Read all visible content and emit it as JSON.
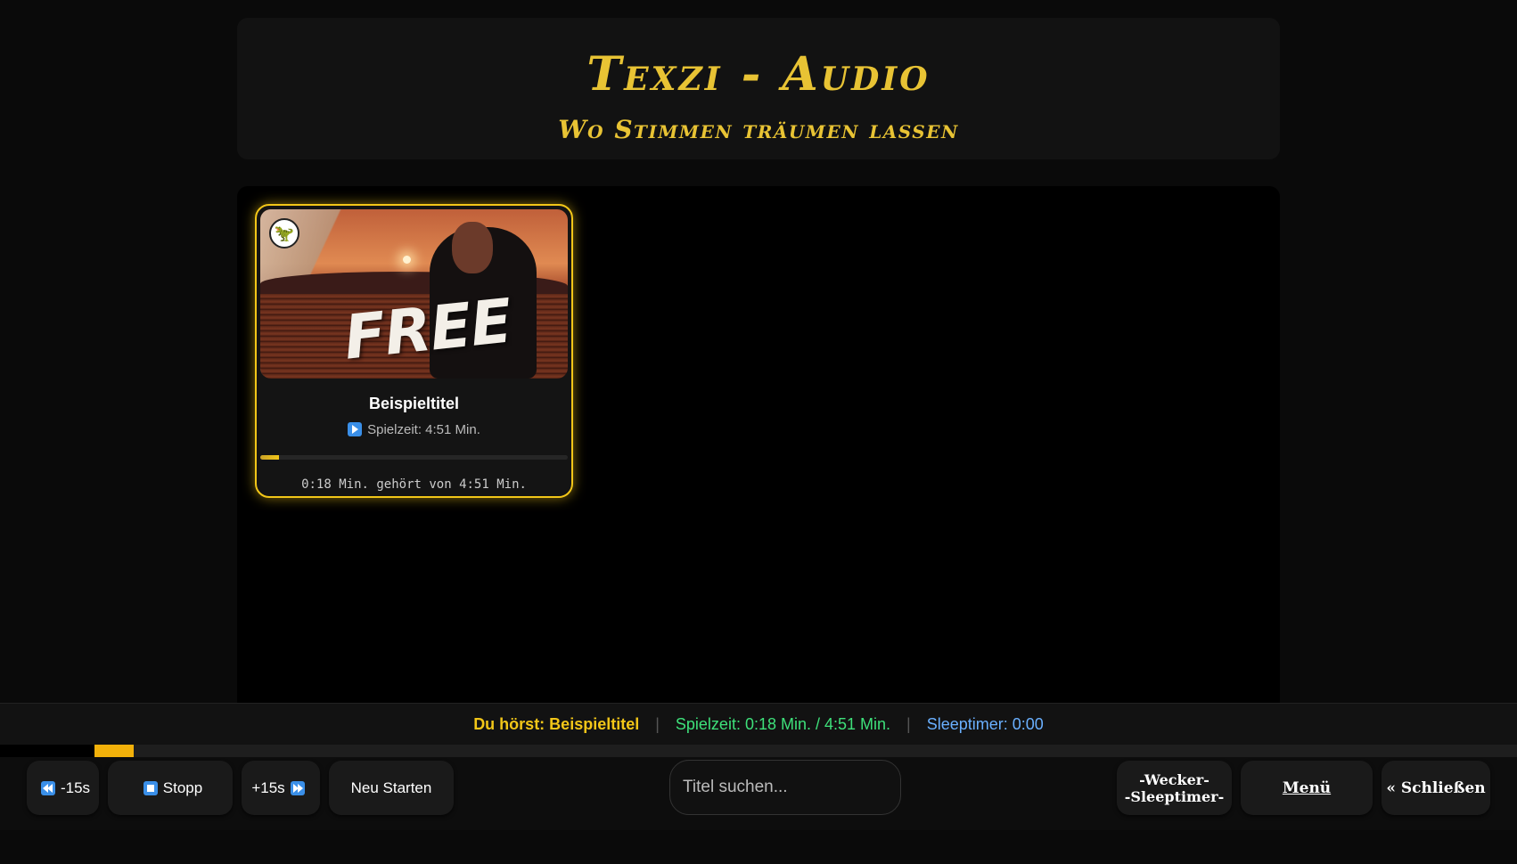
{
  "header": {
    "title": "Texzi - Audio",
    "subtitle": "Wo Stimmen träumen lassen"
  },
  "card": {
    "thumbnail_text": "FREE",
    "title": "Beispieltitel",
    "playtime_label": "Spielzeit: 4:51 Min.",
    "progress_fraction": 0.062,
    "listened_text": "0:18 Min. gehört von 4:51 Min."
  },
  "status": {
    "now_playing": "Du hörst: Beispieltitel",
    "separator": "|",
    "playtime": "Spielzeit: 0:18 Min. / 4:51 Min.",
    "sleeptimer": "Sleeptimer: 0:00"
  },
  "seek": {
    "progress_fraction": 0.062
  },
  "controls": {
    "rewind_label": "-15s",
    "stop_label": "Stopp",
    "forward_label": "+15s",
    "restart_label": "Neu Starten",
    "search_placeholder": "Titel suchen...",
    "alarm_line1": "-Wecker-",
    "alarm_line2": "-Sleeptimer-",
    "menu_label": "Menü",
    "close_label": "« Schließen"
  },
  "colors": {
    "accent": "#f2c618",
    "now_playing": "#f2c618",
    "playtime": "#3ee07a",
    "sleeptimer": "#6ab0ff",
    "icon_blue": "#3a8fe8"
  }
}
